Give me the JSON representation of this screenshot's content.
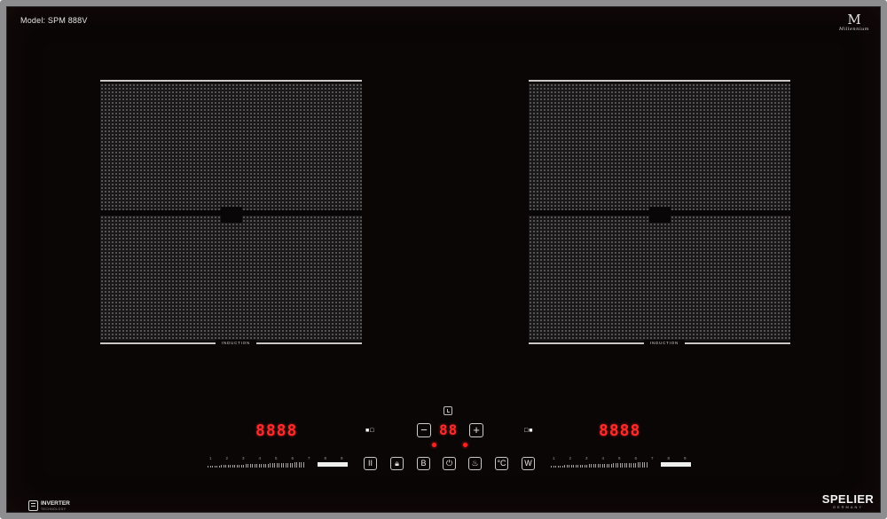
{
  "model": "Model: SPM 888V",
  "brand_top": {
    "mark": "M",
    "name": "Millennium"
  },
  "zones": [
    {
      "label": "INDUCTION"
    },
    {
      "label": "INDUCTION"
    }
  ],
  "displays": {
    "left": "8888",
    "timer": "88",
    "right": "8888"
  },
  "zone_select": {
    "left": "■□",
    "right": "□■"
  },
  "timer_keys": {
    "minus": "−",
    "plus": "+"
  },
  "slider": {
    "numbers": [
      "1",
      "2",
      "3",
      "4",
      "5",
      "6",
      "7",
      "8",
      "9"
    ]
  },
  "function_keys": [
    {
      "icon": "pause-icon",
      "label": "II"
    },
    {
      "icon": "lock-icon",
      "label": "🔒︎"
    },
    {
      "icon": "boost-icon",
      "label": "B"
    },
    {
      "icon": "power-icon",
      "label": "⏻"
    },
    {
      "icon": "keep-warm-icon",
      "label": "♨"
    },
    {
      "icon": "temperature-icon",
      "label": "°C"
    },
    {
      "icon": "wok-icon",
      "label": "W"
    }
  ],
  "inverter": {
    "label": "INVERTER",
    "sub": "TECHNOLOGY"
  },
  "brand": {
    "name": "SPELIER",
    "sub": "GERMANY"
  },
  "colors": {
    "display_red": "#ff2a2a",
    "glass": "#0a0606",
    "frame": "#8d8d8f"
  }
}
